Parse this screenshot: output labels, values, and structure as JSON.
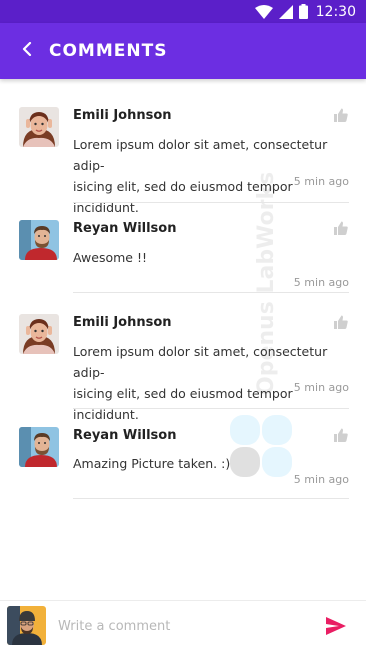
{
  "status_bar": {
    "time": "12:30",
    "icons": [
      "wifi-icon",
      "cell-signal-icon",
      "battery-icon"
    ]
  },
  "app_bar": {
    "title": "COMMENTS",
    "back_icon": "chevron-left-icon"
  },
  "comments": [
    {
      "author": "Emili Johnson",
      "text_lines": [
        "Lorem ipsum dolor sit amet, consectetur adip-",
        "isicing elit, sed do eiusmod tempor incididunt."
      ],
      "time": "5 min ago",
      "like_icon": "thumbs-up-icon"
    },
    {
      "author": "Reyan Willson",
      "text_lines": [
        "Awesome !!"
      ],
      "time": "5 min ago",
      "like_icon": "thumbs-up-icon"
    },
    {
      "author": "Emili Johnson",
      "text_lines": [
        "Lorem ipsum dolor sit amet, consectetur adip-",
        "isicing elit, sed do eiusmod tempor incididunt."
      ],
      "time": "5 min ago",
      "like_icon": "thumbs-up-icon"
    },
    {
      "author": "Reyan Willson",
      "text_lines": [
        "Amazing Picture taken. :)"
      ],
      "time": "5 min ago",
      "like_icon": "thumbs-up-icon"
    }
  ],
  "watermark": "Openus LabWorks",
  "composer": {
    "placeholder": "Write a comment",
    "send_icon": "send-icon"
  },
  "colors": {
    "status_bar": "#5b1fc9",
    "app_bar": "#6c2ee2",
    "send_accent": "#e91e63"
  }
}
